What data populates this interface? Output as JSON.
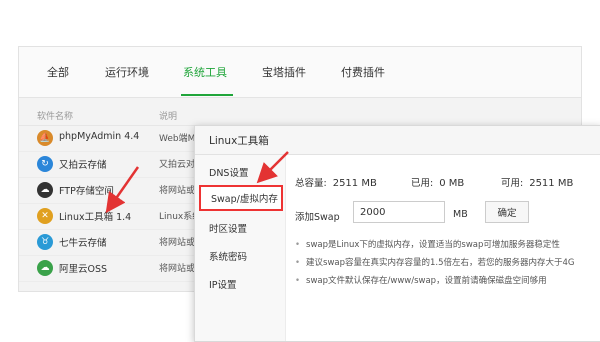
{
  "tabs": [
    "全部",
    "运行环境",
    "系统工具",
    "宝塔插件",
    "付费插件"
  ],
  "active_tab": 2,
  "table": {
    "headers": [
      "软件名称",
      "说明"
    ],
    "rows": [
      {
        "icon": "phpmyadmin-icon",
        "name": "phpMyAdmin 4.4",
        "desc": "Web端M",
        "color": "#d98a2b"
      },
      {
        "icon": "upyun-icon",
        "name": "又拍云存储",
        "desc": "又拍云对",
        "color": "#2b86d9"
      },
      {
        "icon": "ftp-storage-icon",
        "name": "FTP存储空间",
        "desc": "将网站或",
        "color": "#333333"
      },
      {
        "icon": "tools-icon",
        "name": "Linux工具箱 1.4",
        "desc": "Linux系统",
        "color": "#e0a020"
      },
      {
        "icon": "qiniu-icon",
        "name": "七牛云存储",
        "desc": "将网站或",
        "color": "#2a9ad6"
      },
      {
        "icon": "aliyun-oss-icon",
        "name": "阿里云OSS",
        "desc": "将网站或",
        "color": "#3aa24a"
      }
    ]
  },
  "dialog": {
    "title": "Linux工具箱",
    "menu": [
      "DNS设置",
      "Swap/虚拟内存",
      "时区设置",
      "系统密码",
      "IP设置"
    ],
    "active_menu": 1,
    "stats": {
      "total_label": "总容量:",
      "total_value": "2511 MB",
      "used_label": "已用:",
      "used_value": "0 MB",
      "avail_label": "可用:",
      "avail_value": "2511 MB"
    },
    "swap_label": "添加Swap",
    "swap_value": "2000",
    "unit": "MB",
    "confirm": "确定",
    "notes": [
      "swap是Linux下的虚拟内存，设置适当的swap可增加服务器稳定性",
      "建议swap容量在真实内存容量的1.5倍左右，若您的服务器内存大于4G",
      "swap文件默认保存在/www/swap，设置前请确保磁盘空间够用"
    ]
  },
  "colors": {
    "accent": "#20a53a",
    "highlight": "#e33333"
  }
}
